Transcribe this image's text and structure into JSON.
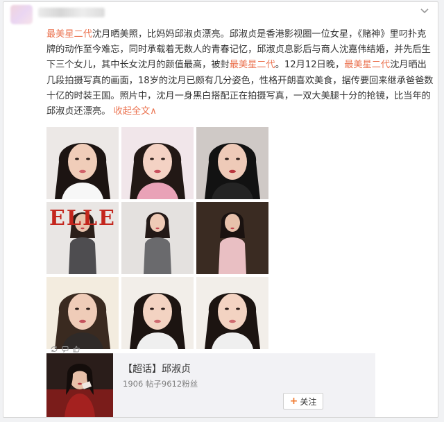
{
  "post": {
    "segments": [
      {
        "text": "最美星二代",
        "style": "hl"
      },
      {
        "text": "沈月晒美照，比妈妈邱淑贞漂亮。邱淑贞是香港影视圈一位女星，《赌神》里叼扑克牌的动作至今难忘，同时承载着无数人的青春记忆，邱淑贞息影后与商人沈嘉伟结婚，并先后生下三个女儿，其中长女沈月的颜值最高，被封",
        "style": ""
      },
      {
        "text": "最美星二代",
        "style": "hl"
      },
      {
        "text": "。12月12日晚，",
        "style": ""
      },
      {
        "text": "最美星二代",
        "style": "hl"
      },
      {
        "text": "沈月晒出几段拍摄写真的画面，18岁的沈月已颇有几分姿色，性格开朗喜欢美食，据传要回来继承爸爸数十亿的时装王国。照片中，沈月一身黑白搭配正在拍摄写真，一双大美腿十分的抢镜，比当年的邱淑贞还漂亮。",
        "style": ""
      }
    ],
    "collapse_link": "收起全文",
    "collapse_arrow": "∧"
  },
  "photos": [
    {
      "name": "photo-portrait-hand-chin",
      "bg": "#ece8e6",
      "hair": "#1c1412",
      "top": "#f7f7f7",
      "skin": "#f0cdb9",
      "lip": "#d0606a"
    },
    {
      "name": "photo-portrait-pink-top",
      "bg": "#f1e6ea",
      "hair": "#221815",
      "top": "#e9a2b7",
      "skin": "#f4d2c4",
      "lip": "#c9505d"
    },
    {
      "name": "photo-portrait-black-hat",
      "bg": "#cfc9c6",
      "hair": "#121212",
      "top": "#242424",
      "skin": "#eecab8",
      "lip": "#b8343d"
    },
    {
      "name": "photo-elle-magazine-cover",
      "bg": "#e9e6e4",
      "hair": "#2b1f1a",
      "top": "#4e4d50",
      "skin": "#e9c4ae",
      "lip": "#c2424b",
      "overlay": "ELLE"
    },
    {
      "name": "photo-full-body-gray-blazer",
      "bg": "#e4e1df",
      "hair": "#231917",
      "top": "#6a6a6d",
      "skin": "#efcab6",
      "lip": "#c44b55"
    },
    {
      "name": "photo-red-carpet-couple",
      "bg": "#3a2b22",
      "hair": "#1a1210",
      "top": "#e9bfc3",
      "skin": "#e8c1ab",
      "lip": "#c24550"
    },
    {
      "name": "photo-mother-daughter",
      "bg": "#f3ecdf",
      "hair": "#3a2a20",
      "top": "#2f2a28",
      "skin": "#efccb8",
      "lip": "#c4515c"
    },
    {
      "name": "photo-selfie-long-hair",
      "bg": "#f2eee9",
      "hair": "#1c1411",
      "top": "#efefef",
      "skin": "#f3d3c2",
      "lip": "#cf6a70"
    },
    {
      "name": "photo-selfie-smile",
      "bg": "#f2eee9",
      "hair": "#1c1411",
      "top": "#efefef",
      "skin": "#f3d3c2",
      "lip": "#cf6a70"
    }
  ],
  "topic": {
    "title": "【超话】邱淑贞",
    "stats": "1906 帖子9612粉丝",
    "follow_plus": "+",
    "follow_label": "关注"
  },
  "icons": {
    "more": "chevron-down-icon",
    "actions": [
      "repost-icon",
      "comment-icon",
      "like-icon"
    ]
  },
  "colors": {
    "highlight": "#eb7350",
    "text": "#333333",
    "muted": "#808080",
    "topic_bg": "#f2f2f5",
    "follow_plus": "#f0772b"
  }
}
